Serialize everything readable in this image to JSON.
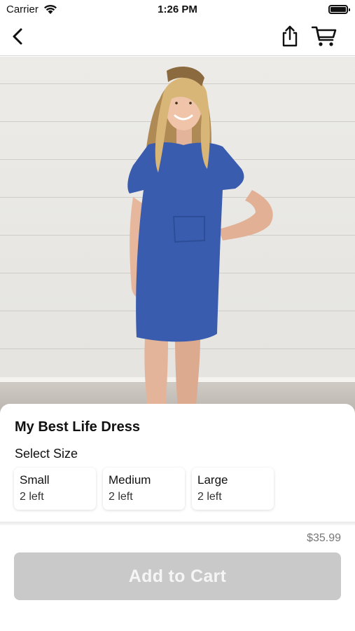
{
  "status_bar": {
    "carrier": "Carrier",
    "time": "1:26 PM"
  },
  "nav": {
    "back_icon": "chevron-left-icon",
    "share_icon": "share-icon",
    "cart_icon": "shopping-cart-icon"
  },
  "product": {
    "title": "My Best Life Dress",
    "image_alt": "Woman wearing a blue t-shirt dress",
    "dress_color": "#3a5cae"
  },
  "size_section": {
    "heading": "Select Size",
    "options": [
      {
        "name": "Small",
        "stock": "2 left"
      },
      {
        "name": "Medium",
        "stock": "2 left"
      },
      {
        "name": "Large",
        "stock": "2 left"
      }
    ]
  },
  "price": "$35.99",
  "add_to_cart": {
    "label": "Add to Cart",
    "disabled_color": "#c9c9c9"
  }
}
